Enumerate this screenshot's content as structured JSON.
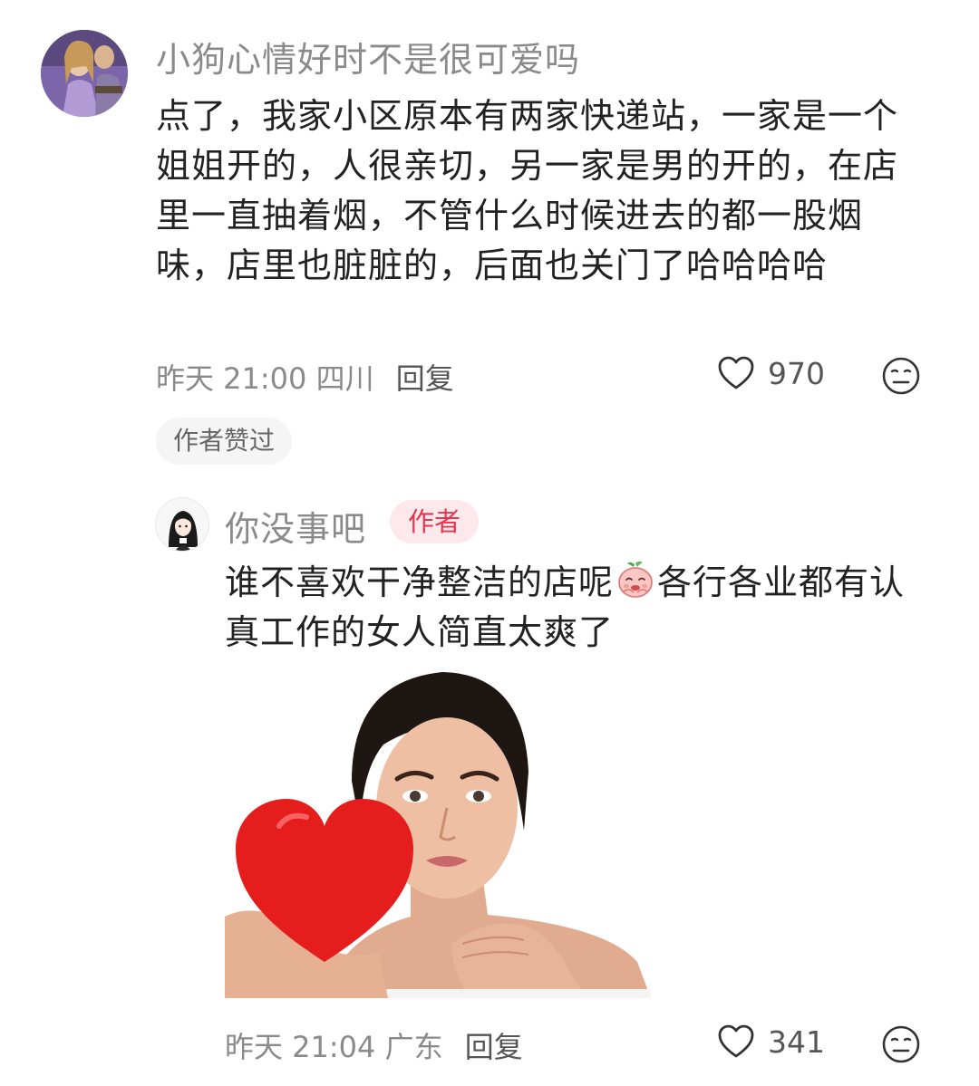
{
  "comment": {
    "username": "小狗心情好时不是很可爱吗",
    "text": "点了，我家小区原本有两家快递站，一家是一个姐姐开的，人很亲切，另一家是男的开的，在店里一直抽着烟，不管什么时候进去的都一股烟味，店里也脏脏的，后面也关门了哈哈哈哈",
    "time": "昨天 21:00",
    "location": "四川",
    "reply_label": "回复",
    "likes": "970",
    "liked_by_author": "作者赞过"
  },
  "reply": {
    "username": "你没事吧",
    "author_badge": "作者",
    "text_before_emoji": "谁不喜欢干净整洁的店呢",
    "emoji": "peach-face-emoji",
    "text_after_emoji": "各行各业都有认真工作的女人简直太爽了",
    "image": "woman-holding-red-heart",
    "time": "昨天 21:04",
    "location": "广东",
    "reply_label": "回复",
    "likes": "341"
  },
  "icons": {
    "like": "heart-outline-icon",
    "emoji_reaction": "neutral-face-icon"
  },
  "colors": {
    "author_badge_bg": "#fde8ec",
    "author_badge_text": "#e4374f",
    "meta_gray": "#8a8a8a",
    "chip_bg": "#f5f5f5"
  }
}
